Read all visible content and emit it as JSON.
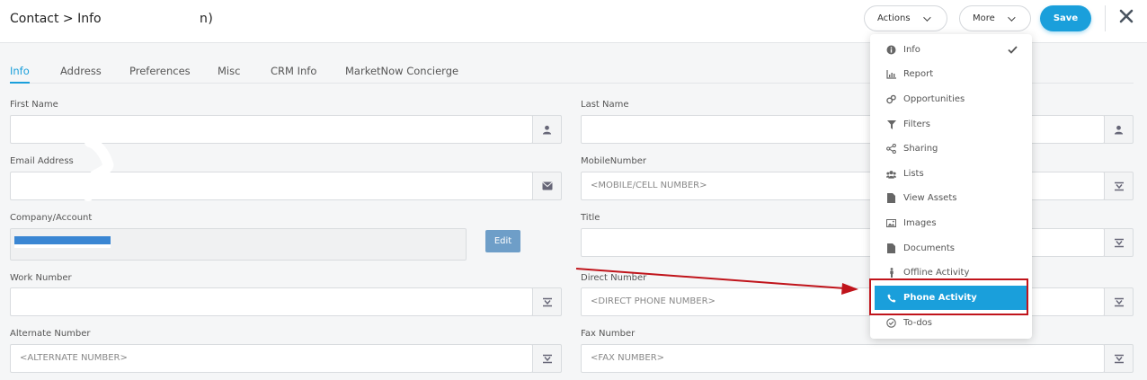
{
  "header": {
    "title": "Contact > Info",
    "title_suffix": "n)",
    "actions_label": "Actions",
    "more_label": "More",
    "save_label": "Save"
  },
  "tabs": [
    {
      "label": "Info"
    },
    {
      "label": "Address"
    },
    {
      "label": "Preferences"
    },
    {
      "label": "Misc"
    },
    {
      "label": "CRM Info"
    },
    {
      "label": "MarketNow Concierge"
    }
  ],
  "fields": {
    "first_name": {
      "label": "First Name",
      "value": ""
    },
    "last_name": {
      "label": "Last Name",
      "value": ""
    },
    "email": {
      "label": "Email Address",
      "value": ""
    },
    "mobile": {
      "label": "MobileNumber",
      "placeholder": "<MOBILE/CELL NUMBER>"
    },
    "company": {
      "label": "Company/Account",
      "edit_label": "Edit"
    },
    "title": {
      "label": "Title",
      "value": ""
    },
    "work": {
      "label": "Work Number",
      "value": ""
    },
    "direct": {
      "label": "Direct Number",
      "placeholder": "<DIRECT PHONE NUMBER>"
    },
    "alternate": {
      "label": "Alternate Number",
      "placeholder": "<ALTERNATE NUMBER>"
    },
    "fax": {
      "label": "Fax Number",
      "placeholder": "<FAX NUMBER>"
    }
  },
  "menu": {
    "items": [
      {
        "label": "Info",
        "icon": "info-icon"
      },
      {
        "label": "Report",
        "icon": "chart-icon"
      },
      {
        "label": "Opportunities",
        "icon": "opportunities-icon"
      },
      {
        "label": "Filters",
        "icon": "filter-icon"
      },
      {
        "label": "Sharing",
        "icon": "share-icon"
      },
      {
        "label": "Lists",
        "icon": "users-icon"
      },
      {
        "label": "View Assets",
        "icon": "file-icon"
      },
      {
        "label": "Images",
        "icon": "image-icon"
      },
      {
        "label": "Documents",
        "icon": "document-icon"
      },
      {
        "label": "Offline Activity",
        "icon": "person-icon"
      },
      {
        "label": "Phone Activity",
        "icon": "phone-icon"
      },
      {
        "label": "To-dos",
        "icon": "check-circle-icon"
      }
    ],
    "checked_item": "Info",
    "highlighted_item": "Phone Activity"
  },
  "colors": {
    "accent": "#1a9fdb",
    "annotation": "#c0141b",
    "edit_button": "#6e9ec8"
  }
}
